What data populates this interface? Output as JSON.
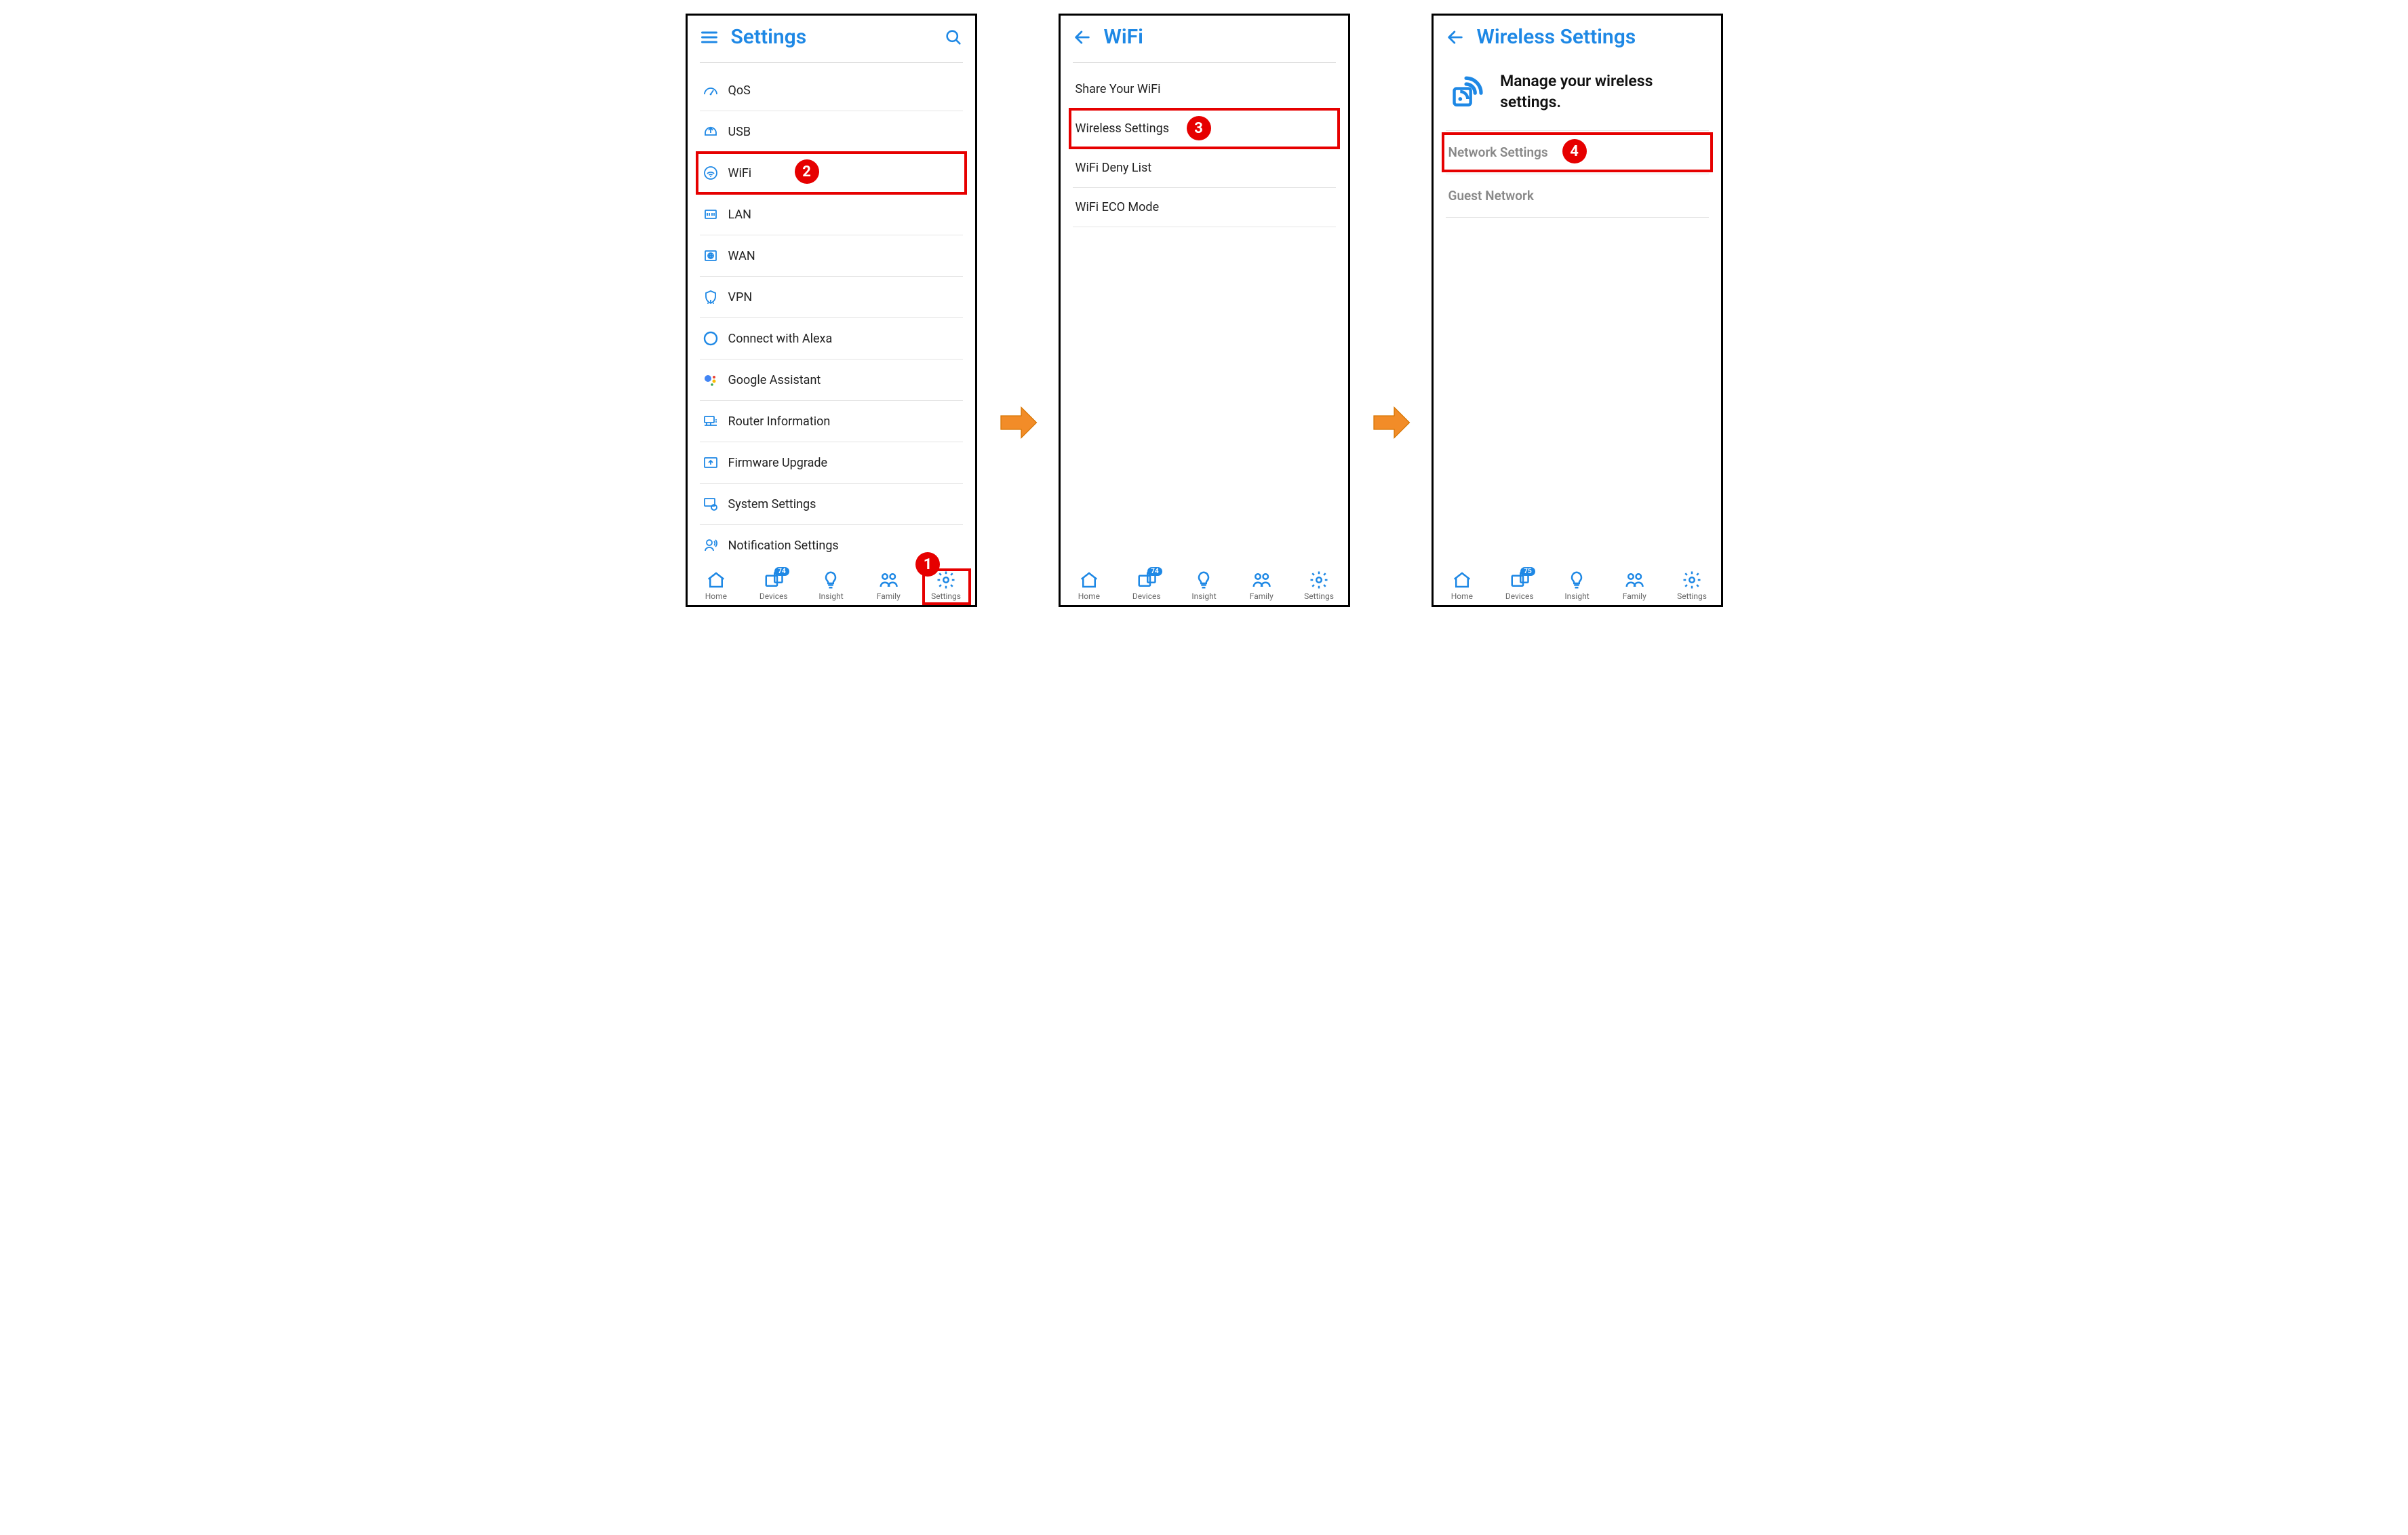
{
  "annotations": {
    "step1": "1",
    "step2": "2",
    "step3": "3",
    "step4": "4"
  },
  "screen1": {
    "title": "Settings",
    "items": [
      {
        "icon": "gauge",
        "label": "QoS"
      },
      {
        "icon": "usb",
        "label": "USB"
      },
      {
        "icon": "wifi",
        "label": "WiFi"
      },
      {
        "icon": "lan",
        "label": "LAN"
      },
      {
        "icon": "wan",
        "label": "WAN"
      },
      {
        "icon": "vpn",
        "label": "VPN"
      },
      {
        "icon": "alexa",
        "label": "Connect with Alexa"
      },
      {
        "icon": "ga",
        "label": "Google Assistant"
      },
      {
        "icon": "router",
        "label": "Router Information"
      },
      {
        "icon": "firmware",
        "label": "Firmware Upgrade"
      },
      {
        "icon": "system",
        "label": "System Settings"
      },
      {
        "icon": "notification",
        "label": "Notification Settings"
      }
    ],
    "nav": {
      "home": "Home",
      "devices": "Devices",
      "insight": "Insight",
      "family": "Family",
      "settings": "Settings",
      "devices_badge": "74"
    }
  },
  "screen2": {
    "title": "WiFi",
    "items": [
      {
        "label": "Share Your WiFi"
      },
      {
        "label": "Wireless Settings"
      },
      {
        "label": "WiFi Deny List"
      },
      {
        "label": "WiFi ECO Mode"
      }
    ],
    "nav": {
      "home": "Home",
      "devices": "Devices",
      "insight": "Insight",
      "family": "Family",
      "settings": "Settings",
      "devices_badge": "74"
    }
  },
  "screen3": {
    "title": "Wireless Settings",
    "intro": "Manage your wireless settings.",
    "sections": [
      {
        "label": "Network Settings"
      },
      {
        "label": "Guest Network"
      }
    ],
    "nav": {
      "home": "Home",
      "devices": "Devices",
      "insight": "Insight",
      "family": "Family",
      "settings": "Settings",
      "devices_badge": "75"
    }
  }
}
